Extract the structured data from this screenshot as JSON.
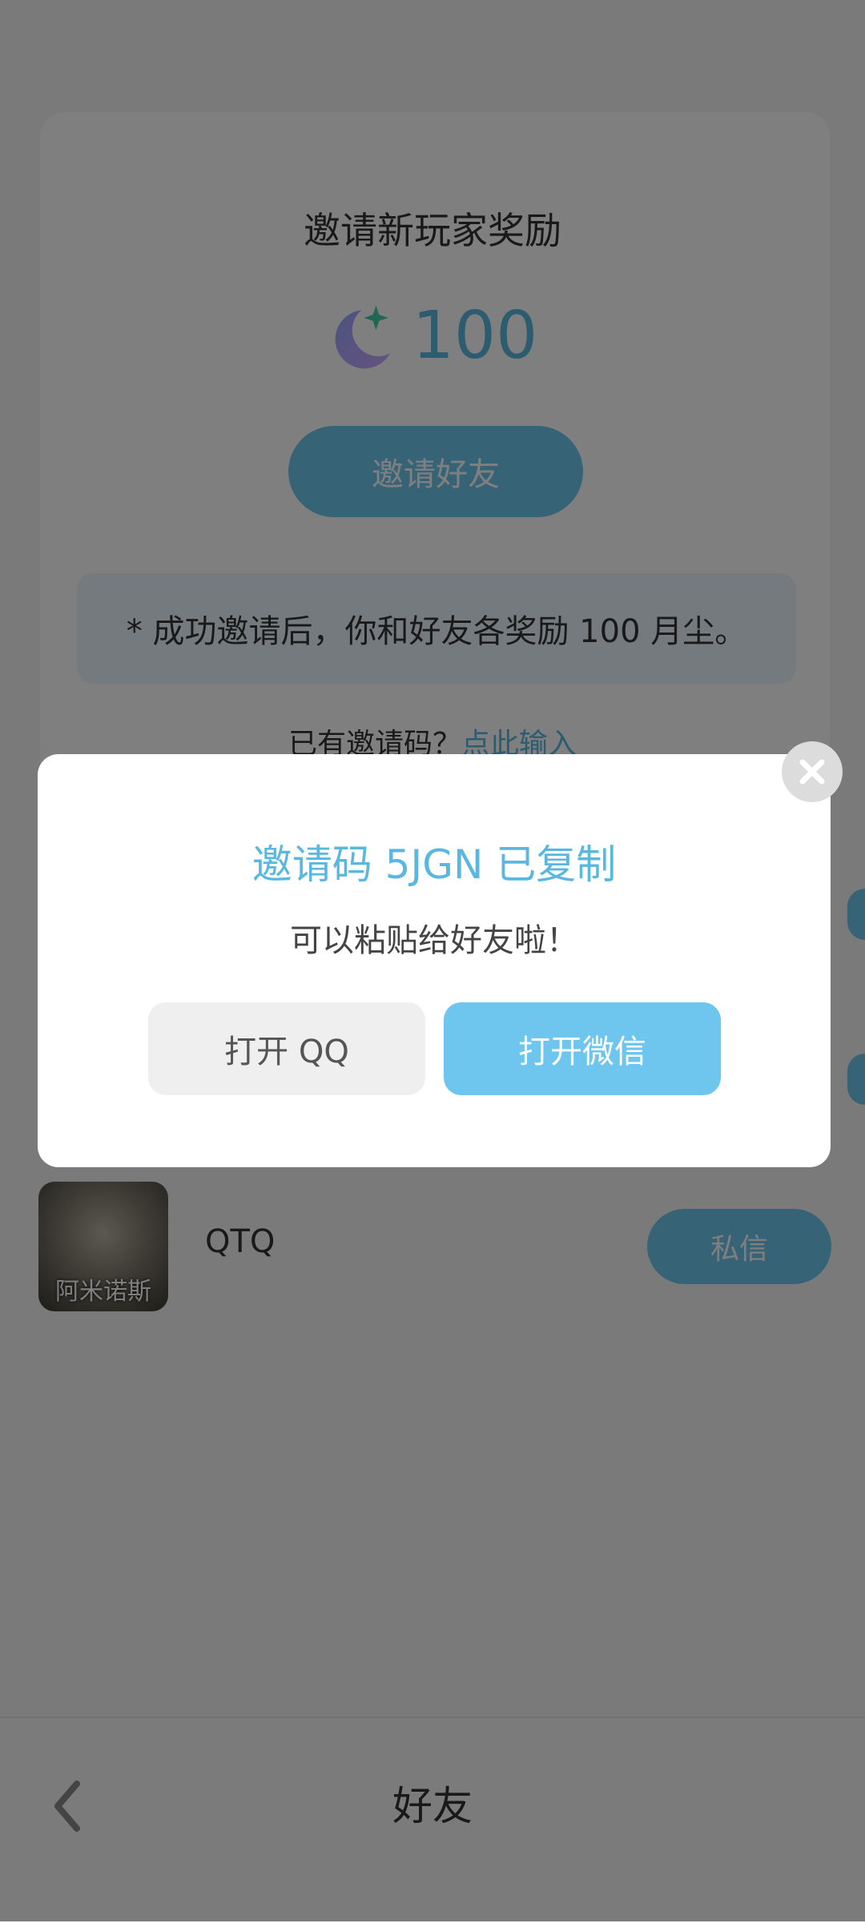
{
  "background": {
    "card": {
      "title": "邀请新玩家奖励",
      "reward_amount": "100",
      "invite_button": "邀请好友",
      "note": "* 成功邀请后，你和好友各奖励 100 月尘。",
      "code_prompt": "已有邀请码？",
      "code_link": "点此输入"
    },
    "friend": {
      "avatar_caption": "阿米诺斯",
      "name": "QTQ",
      "dm_button": "私信"
    },
    "bottom_bar": {
      "title": "好友"
    }
  },
  "dialog": {
    "title": "邀请码 5JGN 已复制",
    "subtitle": "可以粘贴给好友啦！",
    "qq_button": "打开 QQ",
    "wechat_button": "打开微信"
  },
  "colors": {
    "accent": "#6ec6ee",
    "accent_text": "#5ab8e0",
    "overlay": "rgba(0,0,0,0.5)"
  },
  "icons": [
    "moon-star-icon",
    "close-icon",
    "back-chevron-icon"
  ]
}
